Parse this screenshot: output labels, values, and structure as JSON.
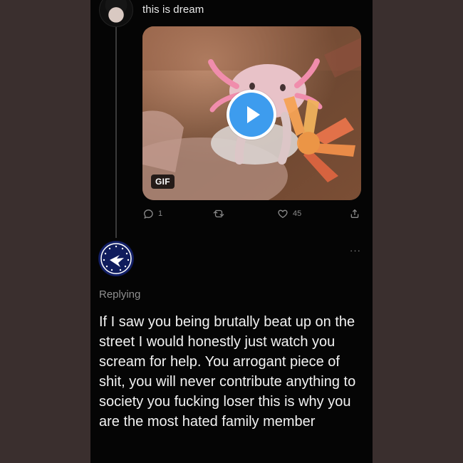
{
  "top_post": {
    "text": "this is dream",
    "gif_label": "GIF",
    "stats": {
      "reply_count": "1",
      "retweet_count": "",
      "like_count": "45"
    }
  },
  "reply": {
    "replying_label": "Replying",
    "text": "If I saw you being brutally beat up on the street I would honestly just watch you scream for help. You arrogant piece of shit, you will never contribute anything to society you fucking loser this is why you are the most hated family member",
    "more_label": "···"
  },
  "colors": {
    "background": "#050505",
    "frame": "#3a2f2e",
    "play_button": "#3d9cee",
    "text_primary": "#f2f2f2",
    "text_secondary": "#8f8f8f",
    "avatar_bottom": "#111a56"
  },
  "icons": {
    "play": "play-icon",
    "reply": "comment-icon",
    "retweet": "retweet-icon",
    "like": "heart-icon",
    "share": "share-icon",
    "more": "more-icon"
  }
}
